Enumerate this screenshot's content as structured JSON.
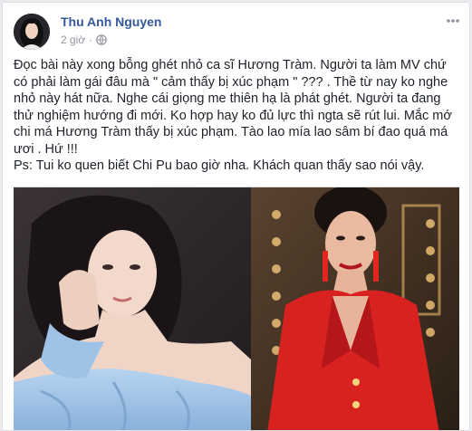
{
  "post": {
    "author": "Thu Anh Nguyen",
    "timestamp": "2 giờ",
    "separator": "·",
    "privacy_icon": "globe-icon",
    "more_icon": "more-options-icon",
    "body": "Đọc bài này xong bỗng ghét nhỏ ca sĩ Hương Tràm. Người ta làm MV chứ có phải làm gái đâu mà \" cảm thấy bị xúc phạm \" ??? . Thề từ nay ko nghe nhỏ này hát nữa. Nghe cái giọng me thiên hạ là phát ghét. Người ta đang thử nghiệm hướng đi mới. Ko hợp hay ko đủ lực thì ngta sẽ rút lui. Mắc mớ chi má Hương Tràm thấy bị xúc phạm. Tào lao mía lao sâm bí đao quá má ươi . Hứ !!!",
    "ps": "Ps: Tui ko quen biết Chi Pu bao giờ nha. Khách quan thấy sao nói vậy."
  },
  "colors": {
    "author_link": "#365899",
    "body_text": "#1d2129",
    "meta_text": "#90949c",
    "photo_left_bg": "#2f2a2e",
    "photo_left_dress": "#9fc3e6",
    "photo_right_bg": "#3a2a1c",
    "photo_right_suit": "#d8221f"
  }
}
